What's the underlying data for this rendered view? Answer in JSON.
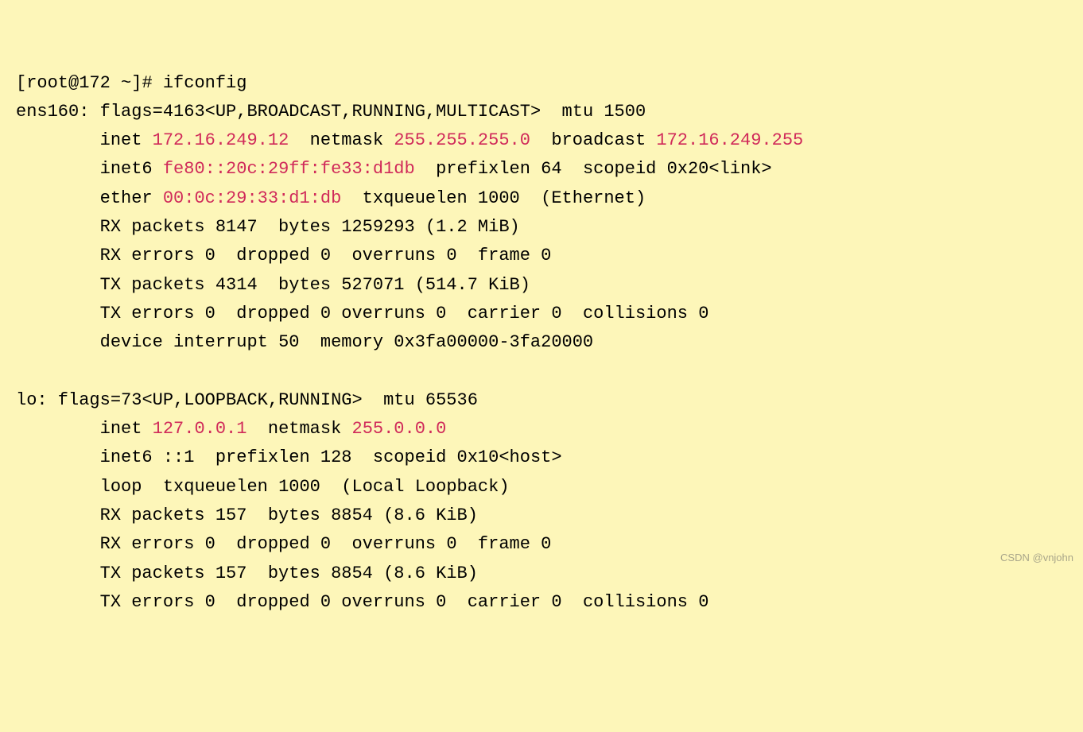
{
  "prompt": {
    "user": "root",
    "host": "172",
    "path": "~",
    "symbol": "#",
    "command": "ifconfig"
  },
  "interfaces": {
    "ens160": {
      "name": "ens160",
      "flags_num": "4163",
      "flags_list": "UP,BROADCAST,RUNNING,MULTICAST",
      "mtu": "1500",
      "inet": "172.16.249.12",
      "netmask": "255.255.255.0",
      "broadcast": "172.16.249.255",
      "inet6": "fe80::20c:29ff:fe33:d1db",
      "prefixlen": "64",
      "scopeid": "0x20",
      "scope_label": "link",
      "ether": "00:0c:29:33:d1:db",
      "txqueuelen": "1000",
      "link_type": "Ethernet",
      "rx_packets": "8147",
      "rx_bytes": "1259293",
      "rx_bytes_human": "1.2 MiB",
      "rx_errors": "0",
      "rx_dropped": "0",
      "rx_overruns": "0",
      "rx_frame": "0",
      "tx_packets": "4314",
      "tx_bytes": "527071",
      "tx_bytes_human": "514.7 KiB",
      "tx_errors": "0",
      "tx_dropped": "0",
      "tx_overruns": "0",
      "tx_carrier": "0",
      "tx_collisions": "0",
      "device_interrupt": "50",
      "device_memory": "0x3fa00000-3fa20000"
    },
    "lo": {
      "name": "lo",
      "flags_num": "73",
      "flags_list": "UP,LOOPBACK,RUNNING",
      "mtu": "65536",
      "inet": "127.0.0.1",
      "netmask": "255.0.0.0",
      "inet6": "::1",
      "prefixlen": "128",
      "scopeid": "0x10",
      "scope_label": "host",
      "loop_label": "loop",
      "txqueuelen": "1000",
      "link_type": "Local Loopback",
      "rx_packets": "157",
      "rx_bytes": "8854",
      "rx_bytes_human": "8.6 KiB",
      "rx_errors": "0",
      "rx_dropped": "0",
      "rx_overruns": "0",
      "rx_frame": "0",
      "tx_packets": "157",
      "tx_bytes": "8854",
      "tx_bytes_human": "8.6 KiB",
      "tx_errors": "0",
      "tx_dropped": "0",
      "tx_overruns": "0",
      "tx_carrier": "0",
      "tx_collisions": "0"
    }
  },
  "watermark": "CSDN @vnjohn"
}
